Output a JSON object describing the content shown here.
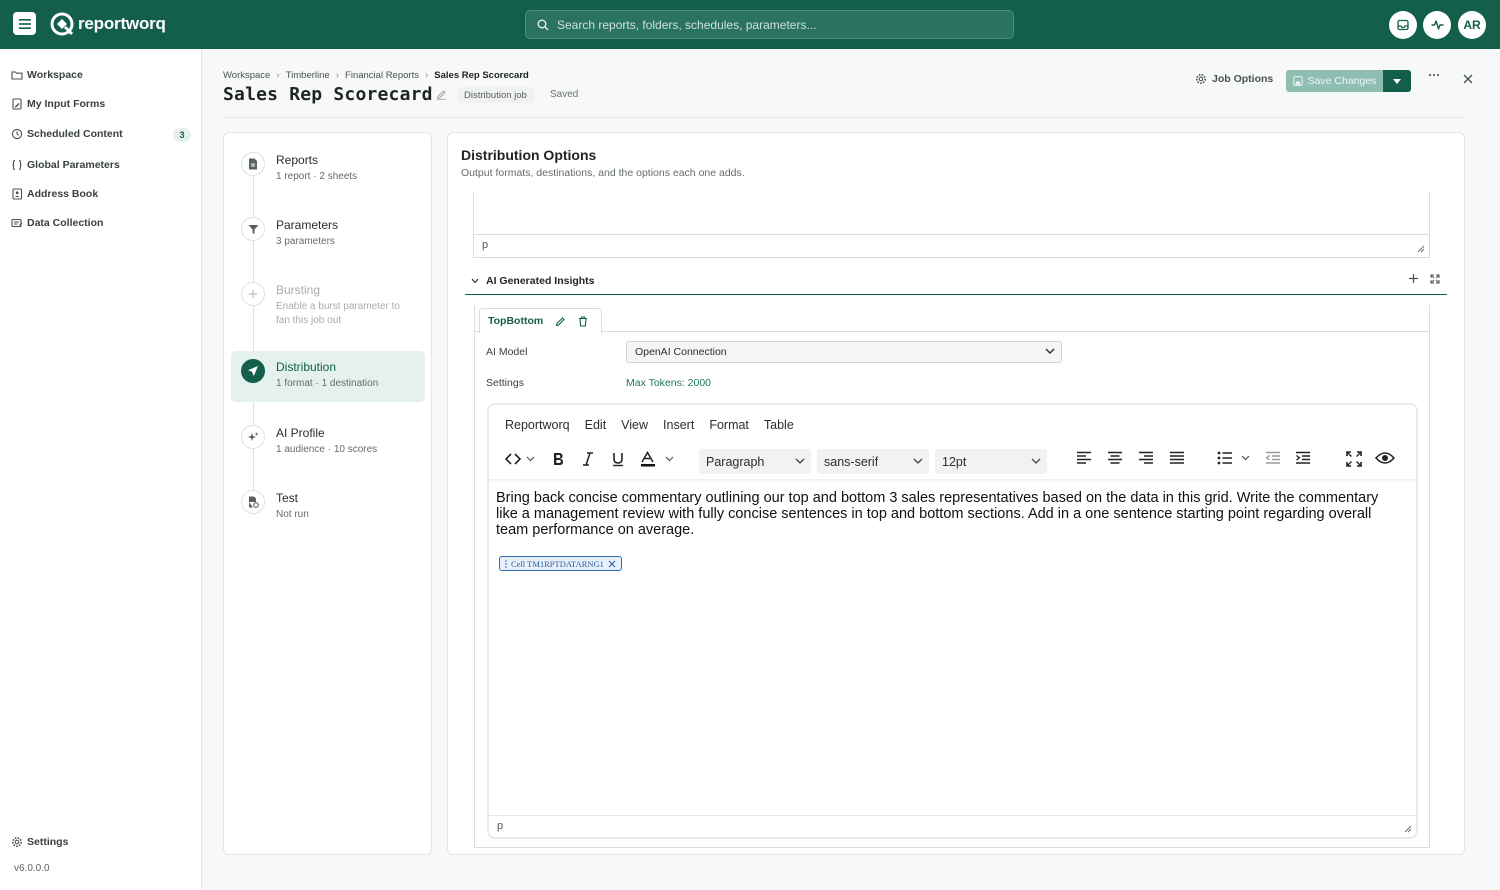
{
  "app": {
    "brand": "reportworq",
    "search_placeholder": "Search reports, folders, schedules, parameters...",
    "avatar_initials": "AR",
    "accent_color": "#135f4c"
  },
  "sidebar": {
    "items": [
      {
        "label": "Workspace",
        "icon": "folder-icon"
      },
      {
        "label": "My Input Forms",
        "icon": "form-icon"
      },
      {
        "label": "Scheduled Content",
        "icon": "clock-icon",
        "badge": "3"
      },
      {
        "label": "Global Parameters",
        "icon": "braces-icon"
      },
      {
        "label": "Address Book",
        "icon": "address-book-icon"
      },
      {
        "label": "Data Collection",
        "icon": "data-collection-icon"
      }
    ],
    "settings_label": "Settings",
    "version": "v6.0.0.0"
  },
  "header": {
    "breadcrumb": [
      "Workspace",
      "Timberline",
      "Financial Reports",
      "Sales Rep Scorecard"
    ],
    "title": "Sales Rep Scorecard",
    "job_badge": "Distribution job",
    "status": "Saved",
    "job_options_label": "Job Options",
    "save_label": "Save Changes"
  },
  "steps": [
    {
      "title": "Reports",
      "subtitle": "1 report · 2 sheets"
    },
    {
      "title": "Parameters",
      "subtitle": "3 parameters"
    },
    {
      "title": "Bursting",
      "subtitle": "Enable a burst parameter to fan this job out"
    },
    {
      "title": "Distribution",
      "subtitle": "1 format · 1 destination"
    },
    {
      "title": "AI Profile",
      "subtitle": "1 audience · 10 scores"
    },
    {
      "title": "Test",
      "subtitle": "Not run"
    }
  ],
  "main": {
    "title": "Distribution Options",
    "subtitle": "Output formats, destinations, and the options each one adds.",
    "prev_editor_status": "p",
    "ai_section_label": "AI Generated Insights",
    "tab_label": "TopBottom",
    "ai_model_label": "AI Model",
    "ai_model_value": "OpenAI Connection",
    "settings_label": "Settings",
    "settings_value": "Max Tokens: 2000",
    "editor": {
      "menu": [
        "Reportworq",
        "Edit",
        "View",
        "Insert",
        "Format",
        "Table"
      ],
      "block_format": "Paragraph",
      "font_family": "sans-serif",
      "font_size": "12pt",
      "content": "Bring back concise commentary outlining our top and bottom 3 sales representatives based on the data in this grid.  Write the commentary like a management review with fully concise sentences in top and bottom sections. Add in a one sentence starting point regarding overall team performance on average.",
      "cell_chip": "Cell TM1RPTDATARNG1",
      "status": "p"
    }
  }
}
